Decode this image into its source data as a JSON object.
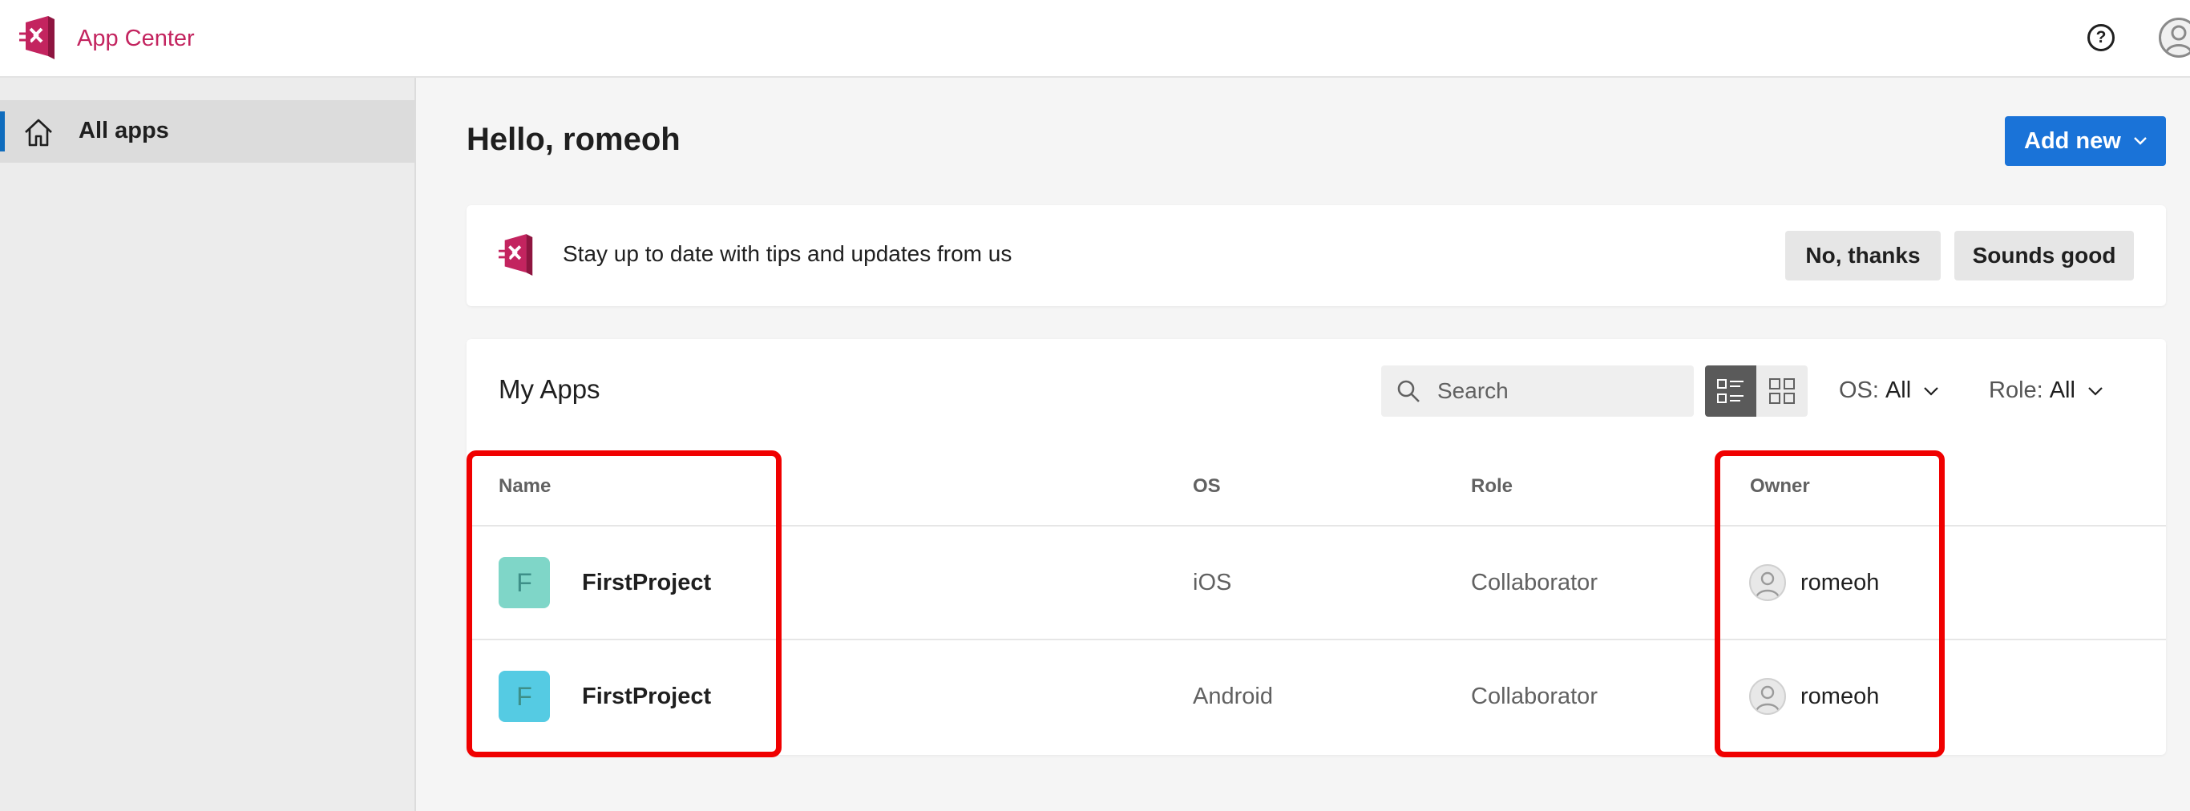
{
  "header": {
    "app_name": "App Center"
  },
  "sidebar": {
    "items": [
      {
        "label": "All apps"
      }
    ]
  },
  "main": {
    "greeting": "Hello, romeoh",
    "add_new_label": "Add new",
    "banner": {
      "text": "Stay up to date with tips and updates from us",
      "decline_label": "No, thanks",
      "accept_label": "Sounds good"
    },
    "apps_panel": {
      "title": "My Apps",
      "search_placeholder": "Search",
      "os_filter": {
        "label": "OS:",
        "value": "All"
      },
      "role_filter": {
        "label": "Role:",
        "value": "All"
      },
      "columns": [
        "Name",
        "OS",
        "Role",
        "Owner"
      ],
      "rows": [
        {
          "initial": "F",
          "name": "FirstProject",
          "os": "iOS",
          "role": "Collaborator",
          "owner": "romeoh",
          "icon_color": "#7fd6c8"
        },
        {
          "initial": "F",
          "name": "FirstProject",
          "os": "Android",
          "role": "Collaborator",
          "owner": "romeoh",
          "icon_color": "#55cbe3"
        }
      ]
    }
  },
  "colors": {
    "brand": "#c3245f",
    "primary_button": "#1a73d8",
    "highlight": "#f00000"
  }
}
